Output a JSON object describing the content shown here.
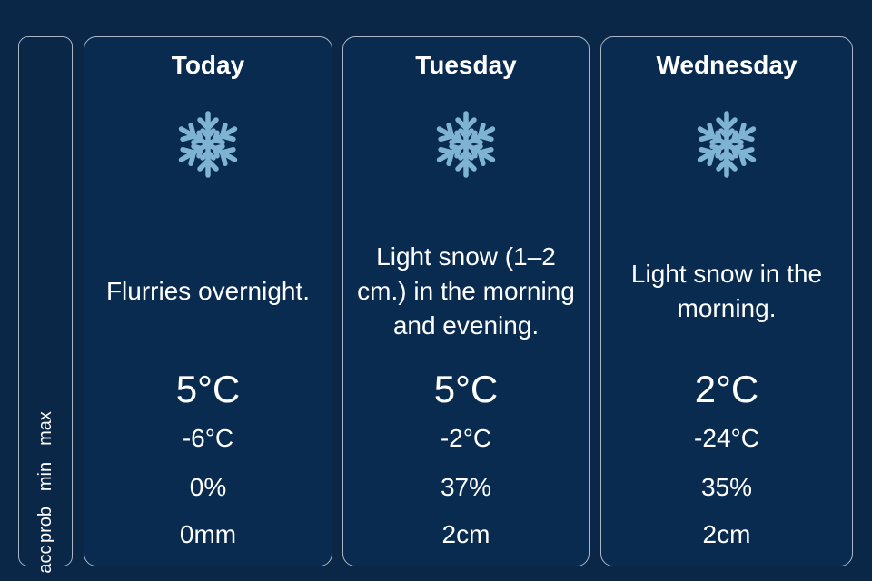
{
  "row_labels": {
    "max": "max",
    "min": "min",
    "prob": "prob",
    "acc": "acc"
  },
  "days": [
    {
      "title": "Today",
      "icon": "snowflake-icon",
      "description": "Flurries overnight.",
      "max": "5°C",
      "min": "-6°C",
      "prob": "0%",
      "acc": "0mm"
    },
    {
      "title": "Tuesday",
      "icon": "snowflake-icon",
      "description": "Light snow (1–2 cm.) in the morning and evening.",
      "max": "5°C",
      "min": "-2°C",
      "prob": "37%",
      "acc": "2cm"
    },
    {
      "title": "Wednesday",
      "icon": "snowflake-icon",
      "description": "Light snow in the morning.",
      "max": "2°C",
      "min": "-24°C",
      "prob": "35%",
      "acc": "2cm"
    }
  ],
  "colors": {
    "background": "#0b2748",
    "card_background": "#0a2b50",
    "border": "#aab6c6",
    "icon": "#7fb3d3",
    "text": "#ffffff"
  }
}
